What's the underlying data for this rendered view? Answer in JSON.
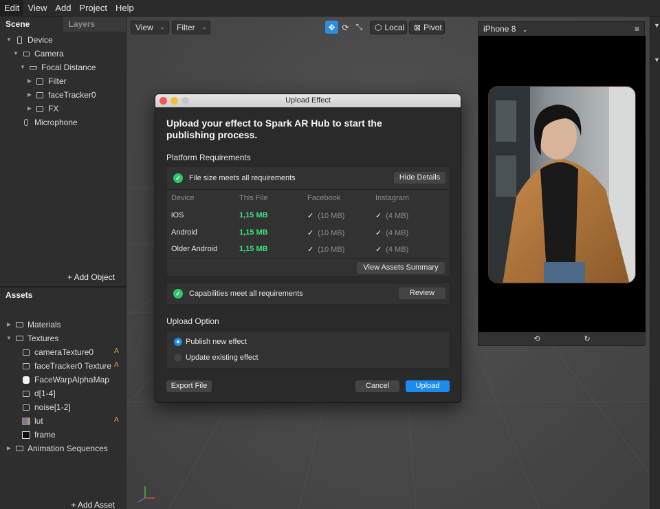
{
  "menu": {
    "items": [
      "Edit",
      "View",
      "Add",
      "Project",
      "Help"
    ]
  },
  "scene_panel": {
    "tabs": [
      "Scene",
      "Layers"
    ],
    "tree": [
      "Device",
      "Camera",
      "Focal Distance",
      "Filter",
      "faceTracker0",
      "FX",
      "Microphone"
    ],
    "add_object": "+ Add Object"
  },
  "assets_panel": {
    "title": "Assets",
    "items": [
      "Materials",
      "Textures",
      "cameraTexture0",
      "faceTracker0 Texture",
      "FaceWarpAlphaMap",
      "d[1-4]",
      "noise[1-2]",
      "lut",
      "frame",
      "Animation Sequences"
    ],
    "badge": "A",
    "add_asset": "+ Add Asset"
  },
  "viewport": {
    "view_label": "View",
    "filter_label": "Filter",
    "local_label": "Local",
    "pivot_label": "Pivot",
    "accent": "#2a8de0"
  },
  "preview": {
    "device": "iPhone 8"
  },
  "dialog": {
    "title": "Upload Effect",
    "headline": "Upload your effect to Spark AR Hub to start the publishing process.",
    "platform_title": "Platform Requirements",
    "file_size_text": "File size meets all requirements",
    "hide_details": "Hide Details",
    "columns": [
      "Device",
      "This File",
      "Facebook",
      "Instagram"
    ],
    "rows": [
      {
        "device": "iOS",
        "size": "1,15 MB",
        "facebook": "(10 MB)",
        "instagram": "(4 MB)"
      },
      {
        "device": "Android",
        "size": "1,15 MB",
        "facebook": "(10 MB)",
        "instagram": "(4 MB)"
      },
      {
        "device": "Older Android",
        "size": "1,15 MB",
        "facebook": "(10 MB)",
        "instagram": "(4 MB)"
      }
    ],
    "check_mark": "✓",
    "view_assets": "View Assets Summary",
    "capabilities_text": "Capabilities meet all requirements",
    "review": "Review",
    "upload_option_title": "Upload Option",
    "option_publish": "Publish new effect",
    "option_update": "Update existing effect",
    "export": "Export File",
    "cancel": "Cancel",
    "upload": "Upload",
    "success_color": "#2fc66b",
    "primary_color": "#1a8cf0"
  }
}
